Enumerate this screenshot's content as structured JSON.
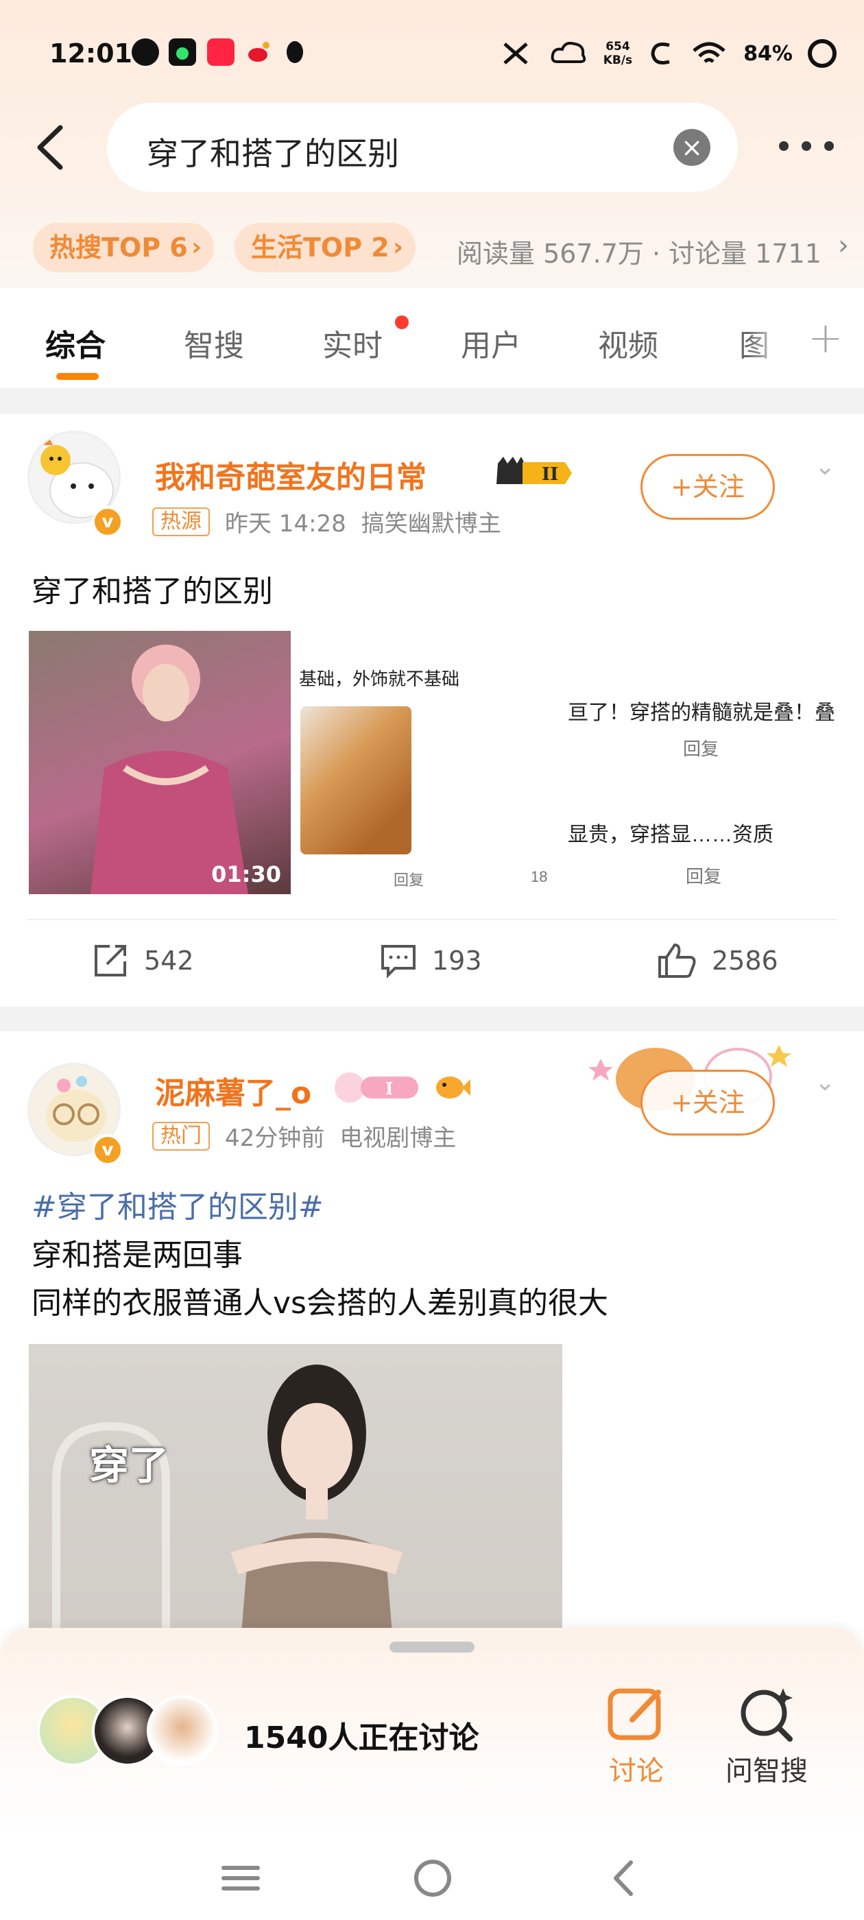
{
  "status_bar": {
    "time": "12:01",
    "net_speed_top": "654",
    "net_speed_bottom": "KB/s",
    "battery": "84%",
    "icons": [
      "weibo-app-icon",
      "music-app-icon",
      "xiaohongshu-app-icon",
      "weibo-icon",
      "qq-icon",
      "bluetooth-icon",
      "signal-icon",
      "wifi-icon"
    ]
  },
  "search": {
    "query": "穿了和搭了的区别"
  },
  "hot": {
    "tag1": "热搜TOP 6",
    "tag2": "生活TOP 2",
    "stats": "阅读量 567.7万 · 讨论量 1711"
  },
  "tabs": [
    "综合",
    "智搜",
    "实时",
    "用户",
    "视频",
    "图"
  ],
  "post1": {
    "username": "我和奇葩室友的日常",
    "level_badge": "II",
    "source_badge": "热源",
    "time": "昨天 14:28",
    "role": "搞笑幽默博主",
    "follow_label": "+关注",
    "text": "穿了和搭了的区别",
    "video_duration": "01:30",
    "comments_shot": {
      "line1": "基础，外饰就不基础",
      "line2": "亘了！穿搭的精髓就是叠！叠",
      "line3": "回复",
      "line4": "显贵，穿搭显……资质",
      "line5": "回复",
      "line6": "回复",
      "line7": "18"
    },
    "reposts": "542",
    "comments": "193",
    "likes": "2586"
  },
  "post2": {
    "username": "泥麻薯了_o",
    "level_badge": "I",
    "source_badge": "热门",
    "time": "42分钟前",
    "role": "电视剧博主",
    "follow_label": "+关注",
    "hashtag": "#穿了和搭了的区别#",
    "line1": "穿和搭是两回事",
    "line2": "同样的衣服普通人vs会搭的人差别真的很大",
    "video_caption": "穿了"
  },
  "bottom_sheet": {
    "discussing": "1540人正在讨论",
    "discuss_label": "讨论",
    "ask_label": "问智搜"
  },
  "colors": {
    "accent": "#f08a35",
    "username": "#f1741d",
    "hashtag": "#4a6ea9",
    "tab_indicator": "#ff8200"
  }
}
